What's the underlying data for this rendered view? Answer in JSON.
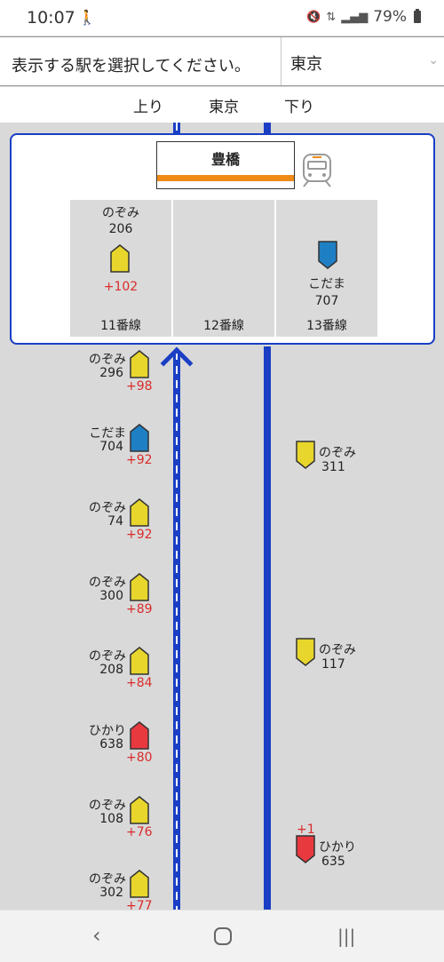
{
  "status": {
    "time": "10:07",
    "battery": "79%"
  },
  "selector": {
    "label": "表示する駅を選択してください。",
    "value": "東京"
  },
  "directions": {
    "up": "上り",
    "center": "東京",
    "down": "下り"
  },
  "station": {
    "name": "豊橋",
    "line_color": "#ef8a17",
    "platforms": [
      {
        "label": "11番線",
        "train": {
          "name": "のぞみ",
          "number": "206",
          "type": "nozomi",
          "delay": "+102"
        }
      },
      {
        "label": "12番線"
      },
      {
        "label": "13番線",
        "train": {
          "name": "こだま",
          "number": "707",
          "type": "kodama"
        }
      }
    ]
  },
  "up_trains": [
    {
      "name": "のぞみ",
      "number": "296",
      "delay": "+98",
      "type": "nozomi"
    },
    {
      "name": "こだま",
      "number": "704",
      "delay": "+92",
      "type": "kodama"
    },
    {
      "name": "のぞみ",
      "number": "74",
      "delay": "+92",
      "type": "nozomi"
    },
    {
      "name": "のぞみ",
      "number": "300",
      "delay": "+89",
      "type": "nozomi"
    },
    {
      "name": "のぞみ",
      "number": "208",
      "delay": "+84",
      "type": "nozomi"
    },
    {
      "name": "ひかり",
      "number": "638",
      "delay": "+80",
      "type": "hikari"
    },
    {
      "name": "のぞみ",
      "number": "108",
      "delay": "+76",
      "type": "nozomi"
    },
    {
      "name": "のぞみ",
      "number": "302",
      "delay": "+77",
      "type": "nozomi"
    }
  ],
  "down_trains": [
    {
      "name": "のぞみ",
      "number": "311",
      "type": "nozomi"
    },
    {
      "name": "のぞみ",
      "number": "117",
      "type": "nozomi"
    },
    {
      "name": "ひかり",
      "number": "635",
      "delay": "+1",
      "type": "hikari"
    }
  ],
  "colors": {
    "nozomi": "#e8d62c",
    "kodama": "#1f7fc4",
    "hikari": "#e8393f",
    "track": "#1a3fc4",
    "delay": "#d92b2b"
  },
  "icons": {
    "back": "back-icon",
    "home": "home-icon",
    "recents": "recents-icon",
    "train": "train-icon"
  }
}
